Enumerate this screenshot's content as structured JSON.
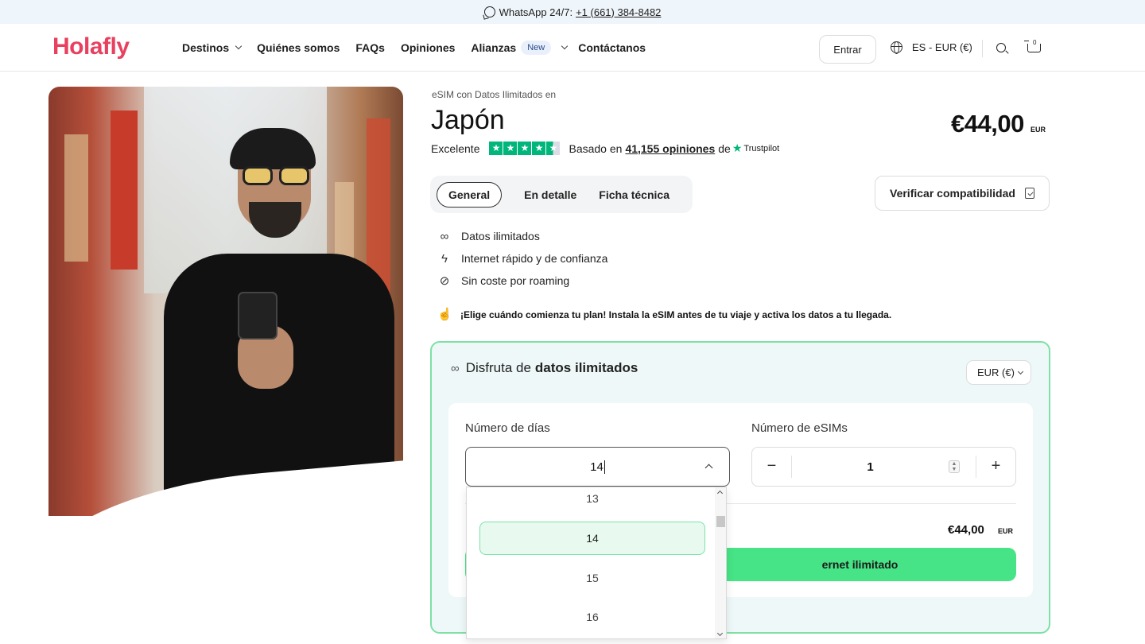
{
  "topbar": {
    "icon": "whatsapp-icon",
    "label": "WhatsApp 24/7:",
    "phone": "+1 (661) 384-8482"
  },
  "header": {
    "logo": "Holafly",
    "nav": [
      {
        "label": "Destinos",
        "has_chevron": true
      },
      {
        "label": "Quiénes somos"
      },
      {
        "label": "FAQs"
      },
      {
        "label": "Opiniones"
      },
      {
        "label": "Alianzas",
        "badge": "New",
        "has_chevron": true
      },
      {
        "label": "Contáctanos"
      }
    ],
    "login_label": "Entrar",
    "language": "ES - EUR (€)",
    "cart_count": "0"
  },
  "product": {
    "eyebrow": "eSIM con Datos Ilimitados en",
    "title": "Japón",
    "price": "€44,00",
    "price_currency": "EUR",
    "rating": {
      "label": "Excelente",
      "stars": 4.5,
      "based_on": "Basado en",
      "count": "41,155 opiniones",
      "de": "de",
      "source": "Trustpilot"
    },
    "tabs": [
      {
        "label": "General",
        "active": true
      },
      {
        "label": "En detalle",
        "active": false
      },
      {
        "label": "Ficha técnica",
        "active": false
      }
    ],
    "verify_label": "Verificar compatibilidad",
    "features": [
      {
        "icon": "infinity-icon",
        "label": "Datos ilimitados"
      },
      {
        "icon": "lightning-icon",
        "label": "Internet rápido y de confianza"
      },
      {
        "icon": "no-roaming-icon",
        "label": "Sin coste por roaming"
      }
    ],
    "notice": "¡Elige cuándo comienza tu plan! Instala la eSIM antes de tu viaje y activa los datos a tu llegada."
  },
  "plan_card": {
    "head_prefix": "Disfruta de",
    "head_bold": "datos ilimitados",
    "currency_select": "EUR (€)",
    "days_label": "Número de días",
    "days_value": "14",
    "esims_label": "Número de eSIMs",
    "esims_value": "1",
    "total": "€44,00",
    "total_currency": "EUR",
    "buy_label_visible": "ernet ilimitado",
    "accent_color": "#46e486",
    "border_color": "#7ee0a6"
  },
  "days_dropdown": {
    "options": [
      "13",
      "14",
      "15",
      "16"
    ],
    "selected": "14"
  }
}
